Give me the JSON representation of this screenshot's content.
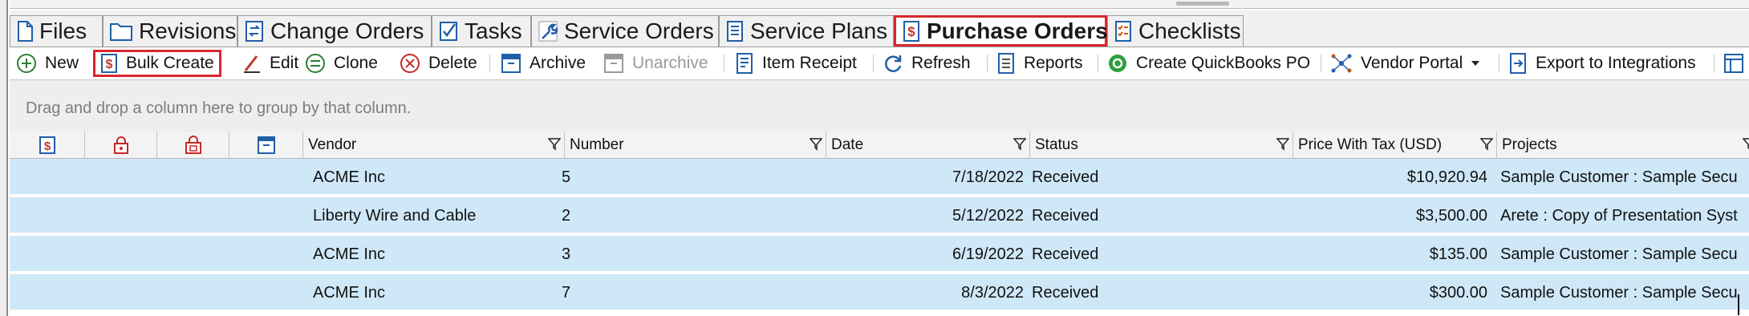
{
  "tabs": [
    {
      "label": "Files",
      "icon": "file-icon"
    },
    {
      "label": "Revisions",
      "icon": "folder-icon"
    },
    {
      "label": "Change Orders",
      "icon": "change-orders-icon"
    },
    {
      "label": "Tasks",
      "icon": "checkbox-icon"
    },
    {
      "label": "Service Orders",
      "icon": "wrench-icon"
    },
    {
      "label": "Service Plans",
      "icon": "document-icon"
    },
    {
      "label": "Purchase Orders",
      "icon": "dollar-document-icon",
      "active": true
    },
    {
      "label": "Checklists",
      "icon": "checklist-icon"
    }
  ],
  "toolbar": {
    "new": "New",
    "bulk_create": "Bulk Create",
    "edit": "Edit",
    "clone": "Clone",
    "delete": "Delete",
    "archive": "Archive",
    "unarchive": "Unarchive",
    "item_receipt": "Item Receipt",
    "refresh": "Refresh",
    "reports": "Reports",
    "create_qb_po": "Create QuickBooks PO",
    "vendor_portal": "Vendor Portal",
    "export": "Export to Integrations"
  },
  "group_panel": {
    "hint": "Drag and drop a column here to group by that column."
  },
  "grid": {
    "icon_columns": [
      "dollar-document-icon",
      "lock-icon",
      "locked-folder-icon",
      "archive-icon"
    ],
    "columns": {
      "vendor": "Vendor",
      "number": "Number",
      "date": "Date",
      "status": "Status",
      "price": "Price With Tax (USD)",
      "projects": "Projects"
    },
    "rows": [
      {
        "vendor": "ACME Inc",
        "number": "5",
        "date": "7/18/2022",
        "status": "Received",
        "price": "$10,920.94",
        "projects": "Sample Customer : Sample Secu"
      },
      {
        "vendor": "Liberty Wire and Cable",
        "number": "2",
        "date": "5/12/2022",
        "status": "Received",
        "price": "$3,500.00",
        "projects": "Arete : Copy of Presentation Syst"
      },
      {
        "vendor": "ACME Inc",
        "number": "3",
        "date": "6/19/2022",
        "status": "Received",
        "price": "$135.00",
        "projects": "Sample Customer : Sample Secu"
      },
      {
        "vendor": "ACME Inc",
        "number": "7",
        "date": "8/3/2022",
        "status": "Received",
        "price": "$300.00",
        "projects": "Sample Customer : Sample Secu"
      }
    ]
  },
  "colors": {
    "accent_red": "#d9262f",
    "row_blue": "#cfe8f8",
    "icon_blue": "#1f5fa8"
  }
}
